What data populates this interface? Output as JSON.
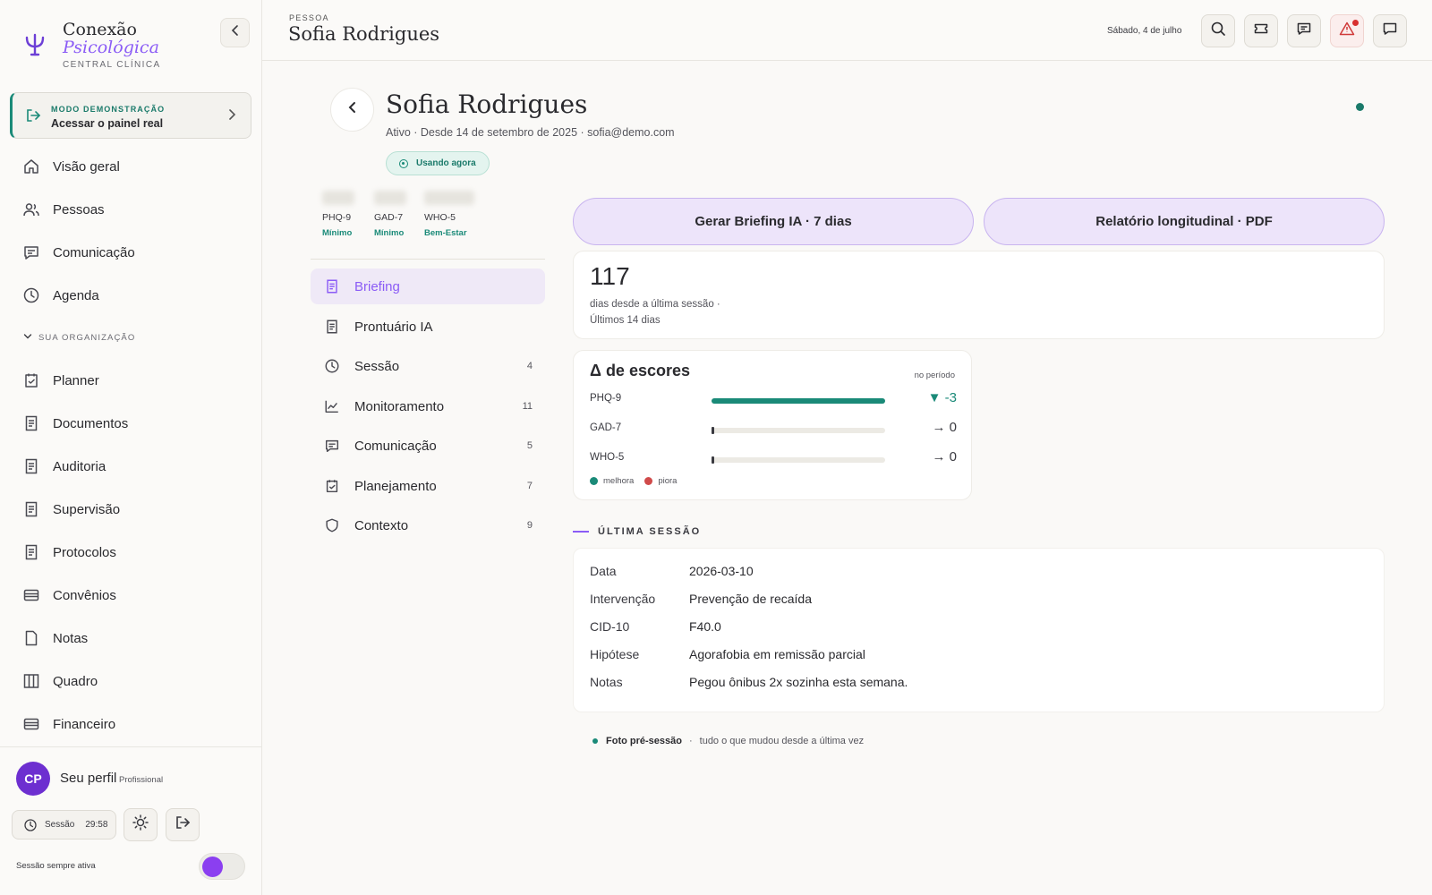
{
  "brand": {
    "line1": "Conexão",
    "line2": "Psicológica",
    "line3": "CENTRAL CLÍNICA",
    "icon": "psi-icon"
  },
  "demo": {
    "kicker": "MODO DEMONSTRAÇÃO",
    "title": "Acessar o painel real"
  },
  "nav": {
    "items": [
      {
        "label": "Visão geral",
        "icon": "home-icon"
      },
      {
        "label": "Pessoas",
        "icon": "users-icon"
      },
      {
        "label": "Comunicação",
        "icon": "message-icon"
      },
      {
        "label": "Agenda",
        "icon": "clock-icon"
      }
    ],
    "org_label": "SUA ORGANIZAÇÃO",
    "org_items": [
      {
        "label": "Planner",
        "icon": "clipboard-check-icon"
      },
      {
        "label": "Documentos",
        "icon": "document-icon"
      },
      {
        "label": "Auditoria",
        "icon": "document-icon"
      },
      {
        "label": "Supervisão",
        "icon": "document-icon"
      },
      {
        "label": "Protocolos",
        "icon": "document-icon"
      },
      {
        "label": "Convênios",
        "icon": "card-icon"
      },
      {
        "label": "Notas",
        "icon": "file-icon"
      },
      {
        "label": "Quadro",
        "icon": "columns-icon"
      },
      {
        "label": "Financeiro",
        "icon": "card-icon"
      }
    ]
  },
  "profile": {
    "initials": "CP",
    "name": "Seu perfil",
    "role": "Profissional",
    "session_label": "Sessão",
    "session_time": "29:58",
    "always_active_label": "Sessão sempre ativa",
    "always_active_on": true
  },
  "topbar": {
    "kicker": "PESSOA",
    "title": "Sofia Rodrigues",
    "date": "Sábado, 4 de julho",
    "buttons": [
      "search-icon",
      "ticket-icon",
      "chat-icon",
      "alert-icon",
      "message-icon"
    ]
  },
  "person": {
    "name": "Sofia Rodrigues",
    "meta": "Ativo · Desde 14 de setembro de 2025 · sofia@demo.com",
    "badge": "Usando agora",
    "status_color": "#1a7a6a"
  },
  "scores": [
    {
      "label": "PHQ-9",
      "level": "Mínimo"
    },
    {
      "label": "GAD-7",
      "level": "Mínimo"
    },
    {
      "label": "WHO-5",
      "level": "Bem-Estar"
    }
  ],
  "tabs": [
    {
      "label": "Briefing",
      "icon": "document-icon",
      "count": "",
      "active": true
    },
    {
      "label": "Prontuário IA",
      "icon": "document-icon",
      "count": ""
    },
    {
      "label": "Sessão",
      "icon": "clock-icon",
      "count": "4"
    },
    {
      "label": "Monitoramento",
      "icon": "chart-line-icon",
      "count": "11"
    },
    {
      "label": "Comunicação",
      "icon": "message-icon",
      "count": "5"
    },
    {
      "label": "Planejamento",
      "icon": "clipboard-check-icon",
      "count": "7"
    },
    {
      "label": "Contexto",
      "icon": "shield-icon",
      "count": "9"
    }
  ],
  "actions": {
    "briefing": "Gerar Briefing IA · 7 dias",
    "report": "Relatório longitudinal · PDF"
  },
  "days_card": {
    "value": "117",
    "line1": "dias desde a última sessão ·",
    "line2": "Últimos 14 dias"
  },
  "delta": {
    "title": "Δ de escores",
    "period": "no período",
    "rows": [
      {
        "name": "PHQ-9",
        "value": "▼ -3",
        "fill": 1.0,
        "good": true
      },
      {
        "name": "GAD-7",
        "value": "→ 0",
        "fill": 0,
        "good": false
      },
      {
        "name": "WHO-5",
        "value": "→ 0",
        "fill": 0,
        "good": false
      }
    ],
    "legend_improve": "melhora",
    "legend_worse": "piora",
    "colors": {
      "improve": "#1a8a78",
      "worse": "#d04a4a"
    }
  },
  "last_session": {
    "heading": "ÚLTIMA SESSÃO",
    "rows": [
      {
        "k": "Data",
        "v": "2026-03-10"
      },
      {
        "k": "Intervenção",
        "v": "Prevenção de recaída"
      },
      {
        "k": "CID-10",
        "v": "F40.0"
      },
      {
        "k": "Hipótese",
        "v": "Agorafobia em remissão parcial"
      },
      {
        "k": "Notas",
        "v": "Pegou ônibus 2x sozinha esta semana."
      }
    ]
  },
  "footer": {
    "strong": "Foto pré-sessão",
    "sep": "·",
    "text": "tudo o que mudou desde a última vez"
  }
}
